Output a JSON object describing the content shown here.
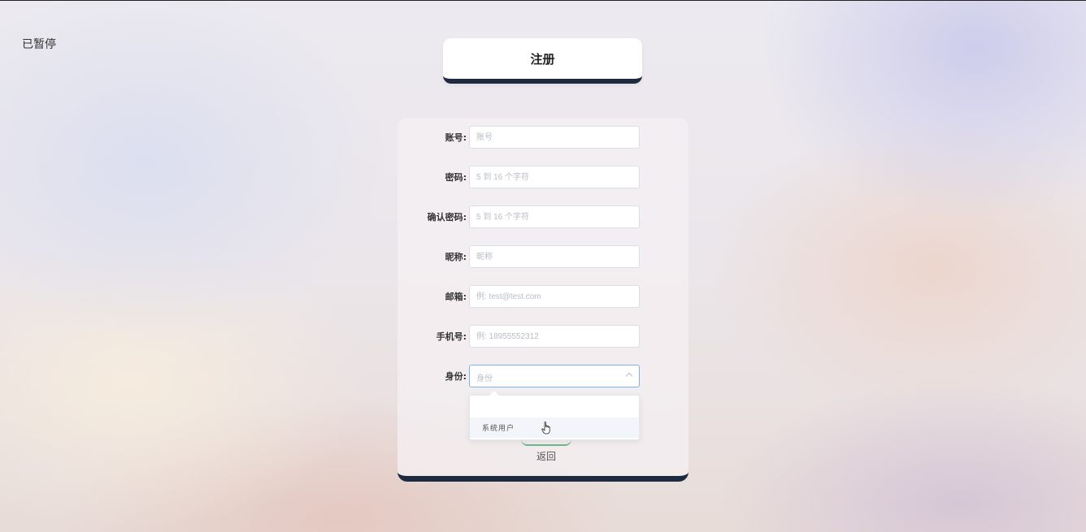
{
  "overlay": {
    "paused_label": "已暂停"
  },
  "header": {
    "title": "注册"
  },
  "form": {
    "fields": [
      {
        "label": "账号:",
        "placeholder": "账号",
        "value": ""
      },
      {
        "label": "密码:",
        "placeholder": "5 到 16 个字符",
        "value": ""
      },
      {
        "label": "确认密码:",
        "placeholder": "5 到 16 个字符",
        "value": ""
      },
      {
        "label": "昵称:",
        "placeholder": "昵称",
        "value": ""
      },
      {
        "label": "邮箱:",
        "placeholder": "例: test@test.com",
        "value": ""
      },
      {
        "label": "手机号:",
        "placeholder": "例: 18955552312",
        "value": ""
      }
    ],
    "identity": {
      "label": "身份:",
      "placeholder": "身份",
      "options": [
        "",
        "系统用户"
      ]
    },
    "back_label": "返回"
  },
  "colors": {
    "accent_dark": "#1e2a3f",
    "focus_border": "#7fb3e6",
    "placeholder": "#b8bdc6",
    "option_hover": "#f2f5fa"
  }
}
